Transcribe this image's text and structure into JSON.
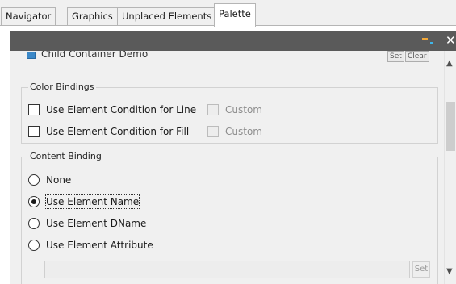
{
  "tabs": [
    {
      "label": "Navigator",
      "active": false
    },
    {
      "label": "Graphics",
      "active": false
    },
    {
      "label": "Unplaced Elements",
      "active": false
    },
    {
      "label": "Palette",
      "active": true
    }
  ],
  "toolbar": {
    "icon": "palette-icon",
    "close_label": "✕"
  },
  "child_container": {
    "label": "Child Container Demo",
    "set_label": "Set",
    "clear_label": "Clear"
  },
  "color_bindings": {
    "title": "Color Bindings",
    "line": {
      "label": "Use Element Condition for Line",
      "checked": false,
      "custom_label": "Custom"
    },
    "fill": {
      "label": "Use Element Condition for Fill",
      "checked": false,
      "custom_label": "Custom"
    }
  },
  "content_binding": {
    "title": "Content Binding",
    "options": [
      {
        "label": "None",
        "selected": false
      },
      {
        "label": "Use Element Name",
        "selected": true
      },
      {
        "label": "Use Element DName",
        "selected": false
      },
      {
        "label": "Use Element Attribute",
        "selected": false
      }
    ],
    "attribute_value": "",
    "set_label": "Set"
  },
  "colors": {
    "toolbar_bg": "#5a5a5a",
    "panel_bg": "#f0f0f0",
    "icon_blue": "#3b88c8"
  }
}
